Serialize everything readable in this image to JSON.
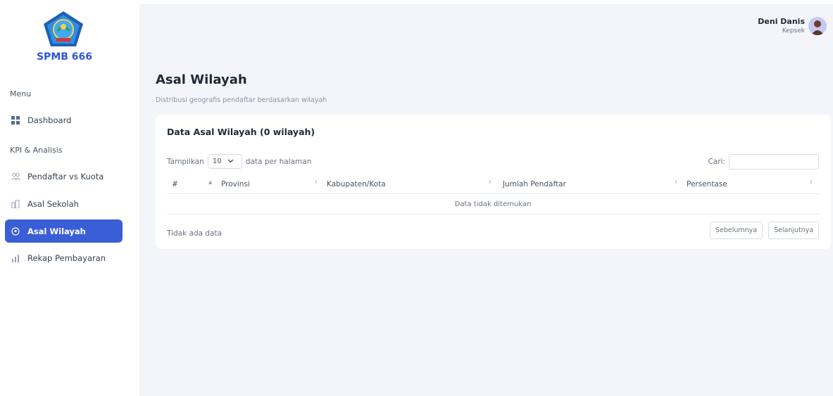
{
  "sidebar": {
    "brand": "SPMB 666",
    "menu_label": "Menu",
    "kpi_label": "KPI & Analisis",
    "items": [
      {
        "label": "Dashboard",
        "icon": "grid-icon"
      },
      {
        "label": "Pendaftar vs Kuota",
        "icon": "users-icon"
      },
      {
        "label": "Asal Sekolah",
        "icon": "building-icon"
      },
      {
        "label": "Asal Wilayah",
        "icon": "location-pin-icon",
        "active": true
      },
      {
        "label": "Rekap Pembayaran",
        "icon": "bar-chart-icon"
      }
    ]
  },
  "user": {
    "name": "Deni Danis",
    "role": "Kepsek"
  },
  "page": {
    "title": "Asal Wilayah",
    "subtitle": "Distribusi geografis pendaftar berdasarkan wilayah"
  },
  "card": {
    "title": "Data Asal Wilayah (0 wilayah)",
    "length": {
      "prefix": "Tampilkan",
      "value": "10",
      "suffix": "data per halaman"
    },
    "search_label": "Cari:",
    "columns": [
      "#",
      "Provinsi",
      "Kabupaten/Kota",
      "Jumlah Pendaftar",
      "Persentase"
    ],
    "empty_text": "Data tidak ditemukan",
    "info": "Tidak ada data",
    "prev_label": "Sebelumnya",
    "next_label": "Selanjutnya"
  },
  "colors": {
    "accent": "#3a5ed6",
    "brand": "#2f56d6",
    "main_bg": "#f3f5fa"
  }
}
